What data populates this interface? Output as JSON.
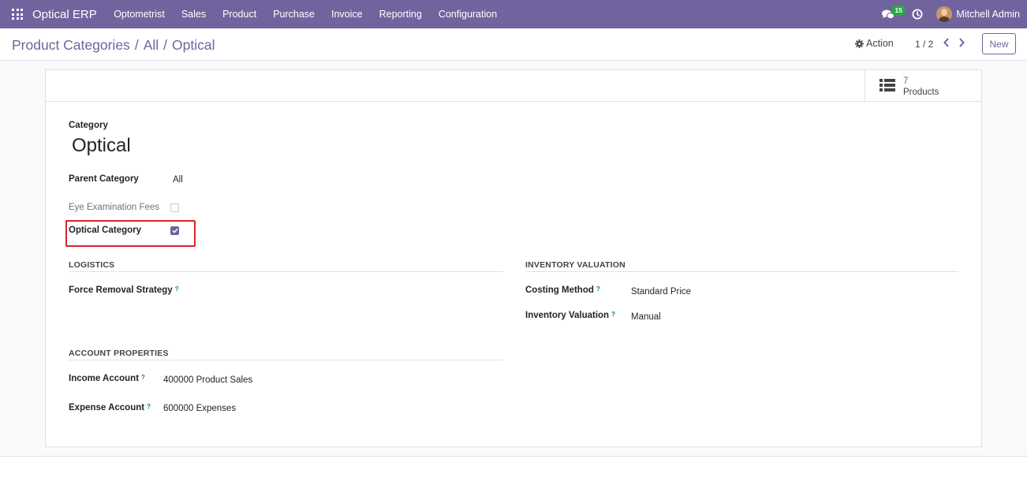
{
  "navbar": {
    "brand": "Optical ERP",
    "menu": [
      "Optometrist",
      "Sales",
      "Product",
      "Purchase",
      "Invoice",
      "Reporting",
      "Configuration"
    ],
    "chat_badge": "15",
    "user_name": "Mitchell Admin",
    "colors": {
      "navbar_bg": "#71639e",
      "badge_bg": "#28a745"
    }
  },
  "control_panel": {
    "breadcrumb": [
      "Product Categories",
      "All",
      "Optical"
    ],
    "action_label": "Action",
    "pager": "1 / 2",
    "new_label": "New"
  },
  "smart_button": {
    "count": "7",
    "label": "Products"
  },
  "form": {
    "category_label": "Category",
    "category_name": "Optical",
    "parent_category_label": "Parent Category",
    "parent_category_value": "All",
    "eye_exam_label": "Eye Examination Fees",
    "eye_exam_checked": false,
    "optical_category_label": "Optical Category",
    "optical_category_checked": true,
    "logistics": {
      "title": "LOGISTICS",
      "removal_strategy_label": "Force Removal Strategy",
      "removal_strategy_value": ""
    },
    "inventory_valuation": {
      "title": "INVENTORY VALUATION",
      "costing_method_label": "Costing Method",
      "costing_method_value": "Standard Price",
      "inventory_valuation_label": "Inventory Valuation",
      "inventory_valuation_value": "Manual"
    },
    "account_properties": {
      "title": "ACCOUNT PROPERTIES",
      "income_account_label": "Income Account",
      "income_account_value": "400000 Product Sales",
      "expense_account_label": "Expense Account",
      "expense_account_value": "600000 Expenses"
    },
    "help_marker": "?"
  },
  "icons": {
    "apps": "apps-grid-icon",
    "chat": "chat-bubbles-icon",
    "clock": "clock-icon",
    "gear": "gear-icon",
    "list": "list-icon",
    "prev": "chevron-left-icon",
    "next": "chevron-right-icon",
    "check": "checkmark-icon"
  },
  "accent_color": "#71639e",
  "highlight_color": "#d9222a"
}
